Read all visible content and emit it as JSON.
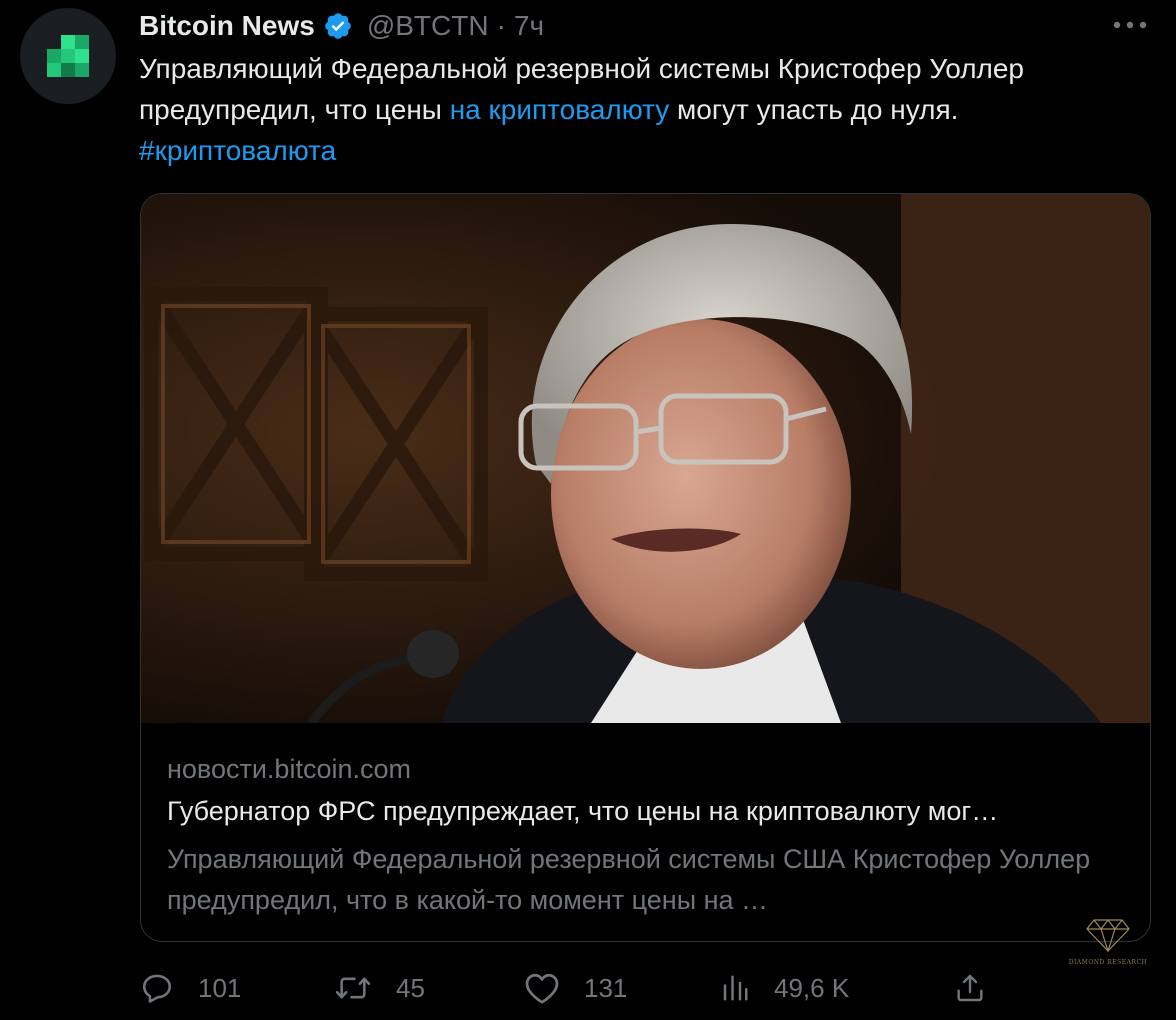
{
  "tweet": {
    "author": {
      "display_name": "Bitcoin News",
      "handle": "@BTCTN",
      "separator": "·",
      "time": "7ч",
      "verified": true,
      "avatar_icon": "pixel-logo-icon",
      "avatar_color": "#21d07a"
    },
    "text": {
      "part1": "Управляющий Федеральной резервной системы Кристофер Уоллер предупредил, что цены ",
      "link": "на криптовалюту",
      "part2": " могут упасть до нуля.",
      "hashtag": "#криптовалюта"
    },
    "card": {
      "domain": "новости.bitcoin.com",
      "title": "Губернатор ФРС предупреждает, что цены на криптовалюту мог…",
      "description": "Управляющий Федеральной резервной системы США Кристофер Уоллер предупредил, что в какой-то момент цены на …"
    },
    "actions": {
      "replies": "101",
      "retweets": "45",
      "likes": "131",
      "views": "49,6 K"
    }
  },
  "watermark": {
    "text": "DIAMOND RESEARCH"
  },
  "colors": {
    "background": "#000000",
    "text": "#e7e9ea",
    "secondary": "#71767b",
    "link": "#1d9bf0",
    "border": "#2f3336",
    "verified": "#1d9bf0"
  }
}
